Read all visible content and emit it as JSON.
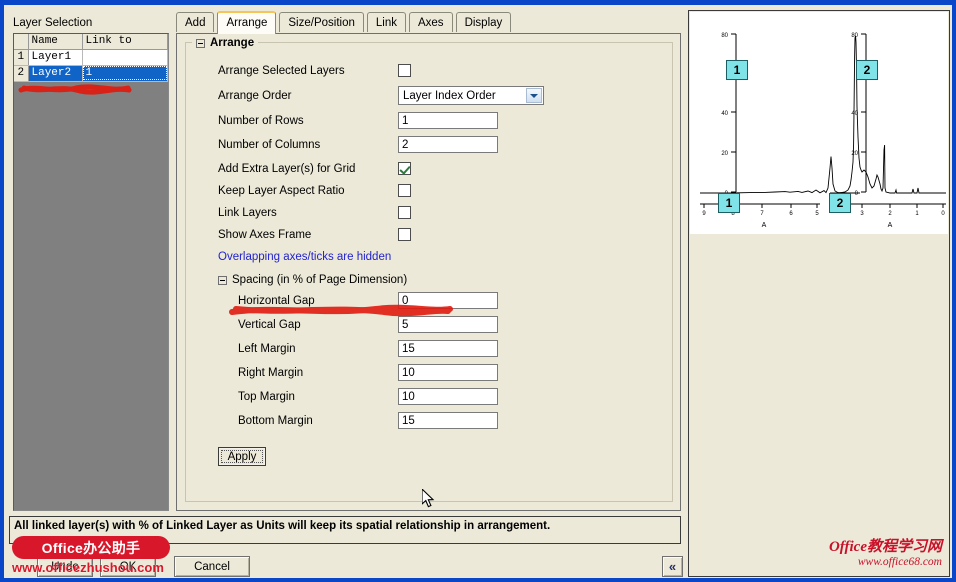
{
  "layer_selection": {
    "title": "Layer Selection",
    "columns": [
      "",
      "Name",
      "Link to"
    ],
    "rows": [
      {
        "index": "1",
        "name": "Layer1",
        "link_to": "",
        "selected": false
      },
      {
        "index": "2",
        "name": "Layer2",
        "link_to": "1",
        "selected": true
      }
    ]
  },
  "tabs": [
    {
      "label": "Add",
      "active": false
    },
    {
      "label": "Arrange",
      "active": true
    },
    {
      "label": "Size/Position",
      "active": false
    },
    {
      "label": "Link",
      "active": false
    },
    {
      "label": "Axes",
      "active": false
    },
    {
      "label": "Display",
      "active": false
    }
  ],
  "arrange": {
    "group_title": "Arrange",
    "fields": {
      "arrange_selected_layers_label": "Arrange Selected Layers",
      "arrange_selected_layers_checked": false,
      "arrange_order_label": "Arrange Order",
      "arrange_order_value": "Layer Index Order",
      "number_of_rows_label": "Number of Rows",
      "number_of_rows_value": "1",
      "number_of_columns_label": "Number of Columns",
      "number_of_columns_value": "2",
      "add_extra_layer_label": "Add Extra Layer(s) for Grid",
      "add_extra_layer_checked": true,
      "keep_layer_aspect_ratio_label": "Keep Layer Aspect Ratio",
      "keep_layer_aspect_ratio_checked": false,
      "link_layers_label": "Link Layers",
      "link_layers_checked": false,
      "show_axes_frame_label": "Show Axes Frame",
      "show_axes_frame_checked": false,
      "overlap_hint": "Overlapping axes/ticks are hidden"
    },
    "spacing": {
      "title": "Spacing (in % of Page Dimension)",
      "horizontal_gap_label": "Horizontal Gap",
      "horizontal_gap_value": "0",
      "vertical_gap_label": "Vertical Gap",
      "vertical_gap_value": "5",
      "left_margin_label": "Left Margin",
      "left_margin_value": "15",
      "right_margin_label": "Right Margin",
      "right_margin_value": "10",
      "top_margin_label": "Top Margin",
      "top_margin_value": "10",
      "bottom_margin_label": "Bottom Margin",
      "bottom_margin_value": "15"
    },
    "apply_label": "Apply"
  },
  "status_text": "All linked layer(s) with % of Linked Layer as Units will keep its spatial relationship in arrangement.",
  "buttons": {
    "undo": "Undo",
    "ok": "OK",
    "cancel": "Cancel",
    "collapse": "«"
  },
  "watermark": {
    "left_pill": "Office办公助手",
    "left_url": "www.officezhushou.com",
    "right_line1": "Office教程学习网",
    "right_line2": "www.office68.com"
  },
  "colors": {
    "window_border": "#0a46c8",
    "dialog_face": "#ece9d8",
    "selection_blue": "#1064c8",
    "badge_cyan": "#7fe3e8",
    "hint_blue": "#2323cc",
    "watermark_red": "#d8172a",
    "scribble_red": "#e01b10"
  },
  "chart_data": {
    "type": "line",
    "title": "",
    "panels": [
      {
        "layer_badge": "1",
        "xlabel": "A",
        "ylabel": "",
        "xlim": [
          9,
          4.5
        ],
        "ylim": [
          -5,
          85
        ],
        "xticks": [
          9,
          8,
          7,
          6,
          5
        ],
        "yticks": [
          0,
          20,
          40,
          80
        ],
        "peaks": [
          {
            "x": 5.3,
            "height": 18
          },
          {
            "x": 6.2,
            "height": 2
          },
          {
            "x": 7.4,
            "height": 1
          }
        ]
      },
      {
        "layer_badge": "2",
        "xlabel": "A",
        "ylabel": "",
        "xlim": [
          4.5,
          0
        ],
        "ylim": [
          -5,
          85
        ],
        "xticks": [
          4,
          3,
          2,
          1,
          0
        ],
        "yticks": [
          0,
          20,
          40,
          80
        ],
        "peaks": [
          {
            "x": 3.35,
            "height": 80
          },
          {
            "x": 3.1,
            "height": 22
          },
          {
            "x": 2.95,
            "height": 11
          },
          {
            "x": 2.65,
            "height": 13
          },
          {
            "x": 2.5,
            "height": 26
          },
          {
            "x": 2.05,
            "height": 3
          },
          {
            "x": 1.1,
            "height": 4
          },
          {
            "x": 1.0,
            "height": 5
          }
        ]
      }
    ]
  }
}
